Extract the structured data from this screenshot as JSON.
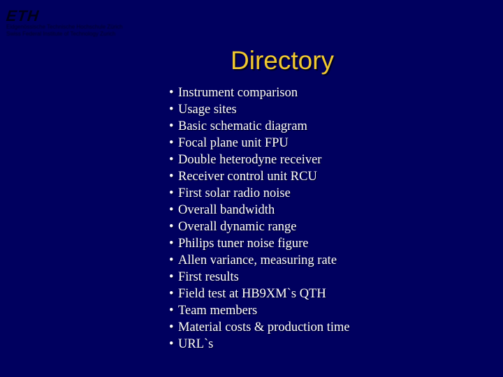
{
  "logo": {
    "mark": "ETH",
    "line1": "Eidgenössische Technische Hochschule Zürich",
    "line2": "Swiss Federal Institute of Technology Zurich"
  },
  "slide": {
    "title": "Directory",
    "bullet_glyph": "•",
    "items": [
      "Instrument comparison",
      "Usage sites",
      "Basic schematic diagram",
      "Focal plane unit FPU",
      "Double heterodyne receiver",
      "Receiver control unit RCU",
      "First solar radio noise",
      "Overall bandwidth",
      "Overall dynamic range",
      "Philips tuner noise figure",
      "Allen variance, measuring rate",
      "First results",
      "Field test at HB9XM`s QTH",
      "Team members",
      "Material costs & production time",
      "URL`s"
    ]
  },
  "colors": {
    "background": "#00005f",
    "title": "#f0c830",
    "text": "#ffffff"
  }
}
